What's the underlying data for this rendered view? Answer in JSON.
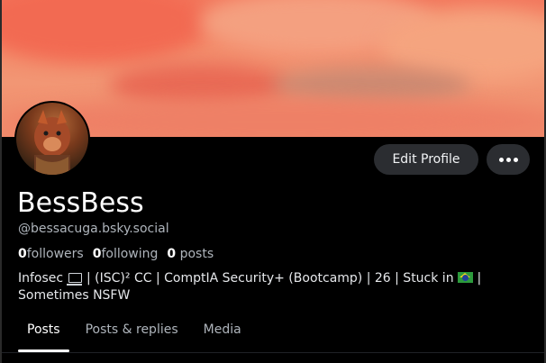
{
  "profile": {
    "display_name": "BessBess",
    "handle": "@bessacuga.bsky.social",
    "stats": {
      "followers_count": "0",
      "followers_label": "followers",
      "following_count": "0",
      "following_label": "following",
      "posts_count": "0",
      "posts_label": "posts"
    },
    "bio": {
      "part1": "Infosec",
      "laptop_icon": "laptop-icon",
      "part2": "| (ISC)² CC | ComptIA Security+ (Bootcamp) | 26 | Stuck in",
      "flag_icon": "brazil-flag-icon",
      "part3": "|",
      "line2": "Sometimes NSFW"
    }
  },
  "actions": {
    "edit_label": "Edit Profile",
    "more_icon": "more-dots-icon"
  },
  "tabs": [
    {
      "label": "Posts",
      "active": true
    },
    {
      "label": "Posts & replies",
      "active": false
    },
    {
      "label": "Media",
      "active": false
    }
  ],
  "colors": {
    "background": "#000000",
    "banner": "#f48d6c",
    "button_bg": "#2b2d31",
    "muted_text": "#aeb4bb",
    "text": "#ffffff"
  }
}
